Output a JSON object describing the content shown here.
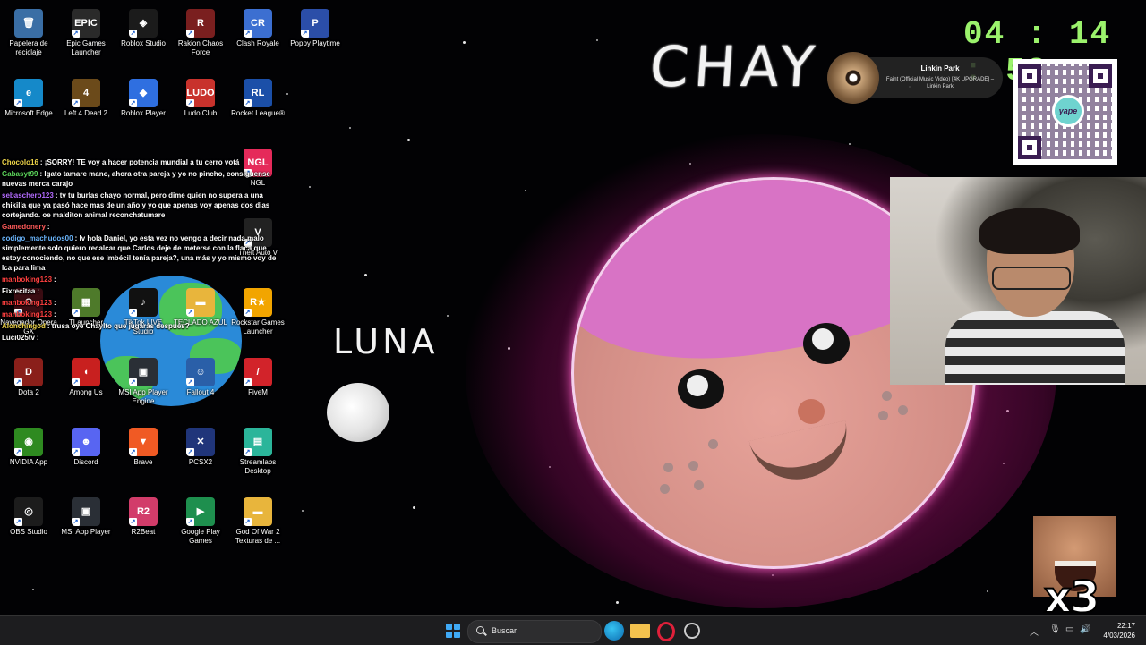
{
  "desktop_icons": [
    {
      "label": "Papelera de reciclaje",
      "icon": "recycle-bin-icon",
      "color": "#3a6ea5",
      "glyph": "🗑"
    },
    {
      "label": "Epic Games Launcher",
      "icon": "epic-games-icon",
      "color": "#2a2a2a",
      "glyph": "EPIC"
    },
    {
      "label": "Roblox Studio",
      "icon": "roblox-studio-icon",
      "color": "#1b1b1b",
      "glyph": "◈"
    },
    {
      "label": "Rakion Chaos Force",
      "icon": "rakion-icon",
      "color": "#7a1f1f",
      "glyph": "R"
    },
    {
      "label": "Clash Royale",
      "icon": "clash-royale-icon",
      "color": "#3c6fd1",
      "glyph": "CR"
    },
    {
      "label": "Poppy Playtime",
      "icon": "poppy-playtime-icon",
      "color": "#2b4ea8",
      "glyph": "P"
    },
    {
      "label": "Microsoft Edge",
      "icon": "edge-icon",
      "color": "#1589c9",
      "glyph": "e"
    },
    {
      "label": "Left 4 Dead 2",
      "icon": "left4dead-icon",
      "color": "#6b4a1a",
      "glyph": "4"
    },
    {
      "label": "Roblox Player",
      "icon": "roblox-player-icon",
      "color": "#2f6fe0",
      "glyph": "◆"
    },
    {
      "label": "Ludo Club",
      "icon": "ludo-club-icon",
      "color": "#c8322c",
      "glyph": "LUDO"
    },
    {
      "label": "Rocket League®",
      "icon": "rocket-league-icon",
      "color": "#1b4fa8",
      "glyph": "RL"
    },
    {
      "label": "NGL",
      "icon": "ngl-icon",
      "color": "#e52a5a",
      "glyph": "NGL"
    },
    {
      "label": "Theft Auto V",
      "icon": "gta-icon",
      "color": "#222222",
      "glyph": "V"
    },
    {
      "label": "Navegador Opera GX",
      "icon": "opera-gx-icon",
      "color": "#3a0c12",
      "glyph": "O"
    },
    {
      "label": "TLauncher",
      "icon": "tlauncher-icon",
      "color": "#4e7a2a",
      "glyph": "▦"
    },
    {
      "label": "TikTok LIVE Studio",
      "icon": "tiktok-icon",
      "color": "#111111",
      "glyph": "♪"
    },
    {
      "label": "TECLADO AZUL",
      "icon": "folder-icon",
      "color": "#e8b53c",
      "glyph": "▬"
    },
    {
      "label": "Rockstar Games Launcher",
      "icon": "rockstar-icon",
      "color": "#f2a500",
      "glyph": "R★"
    },
    {
      "label": "Dota 2",
      "icon": "dota-icon",
      "color": "#8a1f1a",
      "glyph": "D"
    },
    {
      "label": "Among Us",
      "icon": "among-us-icon",
      "color": "#c8201f",
      "glyph": "◖"
    },
    {
      "label": "MSI App Player Engine",
      "icon": "msi-app-player-icon",
      "color": "#2a2f36",
      "glyph": "▣"
    },
    {
      "label": "Fallout 4",
      "icon": "fallout-icon",
      "color": "#2a5fa8",
      "glyph": "☺"
    },
    {
      "label": "FiveM",
      "icon": "fivem-icon",
      "color": "#d2232a",
      "glyph": "/"
    },
    {
      "label": "NVIDIA App",
      "icon": "nvidia-icon",
      "color": "#2e8a20",
      "glyph": "◉"
    },
    {
      "label": "Discord",
      "icon": "discord-icon",
      "color": "#5865f2",
      "glyph": "☻"
    },
    {
      "label": "Brave",
      "icon": "brave-icon",
      "color": "#f05a24",
      "glyph": "▼"
    },
    {
      "label": "PCSX2",
      "icon": "pcsx2-icon",
      "color": "#20357a",
      "glyph": "✕"
    },
    {
      "label": "Streamlabs Desktop",
      "icon": "streamlabs-icon",
      "color": "#2bb59a",
      "glyph": "▤"
    },
    {
      "label": "OBS Studio",
      "icon": "obs-icon",
      "color": "#1c1c1c",
      "glyph": "◎"
    },
    {
      "label": "MSI App Player",
      "icon": "msi-app-player-icon",
      "color": "#2a2f36",
      "glyph": "▣"
    },
    {
      "label": "R2Beat",
      "icon": "r2beat-icon",
      "color": "#d23c6a",
      "glyph": "R2"
    },
    {
      "label": "Google Play Games",
      "icon": "google-play-games-icon",
      "color": "#1e8f4e",
      "glyph": "▶"
    },
    {
      "label": "God Of War 2 Texturas de ...",
      "icon": "folder-icon",
      "color": "#e8b53c",
      "glyph": "▬"
    }
  ],
  "chat": [
    {
      "user": "Chocolo16",
      "color": "#f0d64a",
      "text": ": ¡SORRY! TE voy a hacer potencia mundial a tu cerro votá"
    },
    {
      "user": "Gabasyt99",
      "color": "#5cd65c",
      "text": ": lgato tamare mano, ahora otra pareja y yo no pincho, consiguense nuevas merca carajo"
    },
    {
      "user": "sebaschero123",
      "color": "#b36bff",
      "text": ": tv tu burlas chayo normal, pero dime quien no supera a una chikilla que ya pasó hace mas de un año y yo que apenas voy apenas dos dias cortejando. oe malditon animal reconchatumare"
    },
    {
      "user": "Gamedonery",
      "color": "#ff5a5a",
      "text": ":"
    },
    {
      "user": "codigo_machudos00",
      "color": "#6bb6ff",
      "text": ": lv hola Daniel, yo esta vez no vengo a decir nada malo simplemente solo quiero recalcar que Carlos deje de meterse con la flaca que estoy conociendo, no que ese imbécil tenía pareja?, una más y yo mismo voy de Ica para lima"
    },
    {
      "user": "manboking123",
      "color": "#ff4040",
      "text": ":"
    },
    {
      "user": "Fixrecitaa",
      "color": "#ffffff",
      "text": ":"
    },
    {
      "user": "manboking123",
      "color": "#ff4040",
      "text": ":"
    },
    {
      "user": "manboking123",
      "color": "#ff4040",
      "text": ":"
    },
    {
      "user": "Alonchingod",
      "color": "#f0d64a",
      "text": ": trusa oye Chaylto que jugarás después?"
    },
    {
      "user": "Luci025tv",
      "color": "#ffffff",
      "text": ":"
    }
  ],
  "stream": {
    "title_text": "CHAY",
    "luna_label": "LUNA",
    "timer": "04 : 14 : 58",
    "timer_color": "#9bf26c",
    "qr_brand": "yape",
    "music": {
      "artist": "Linkin Park",
      "track": "Faint (Official Music Video) [4K UPGRADE] – Linkin Park"
    },
    "multiplier": "x3"
  },
  "taskbar": {
    "search_placeholder": "Buscar",
    "time": "22:17",
    "date": "4/03/2026"
  }
}
